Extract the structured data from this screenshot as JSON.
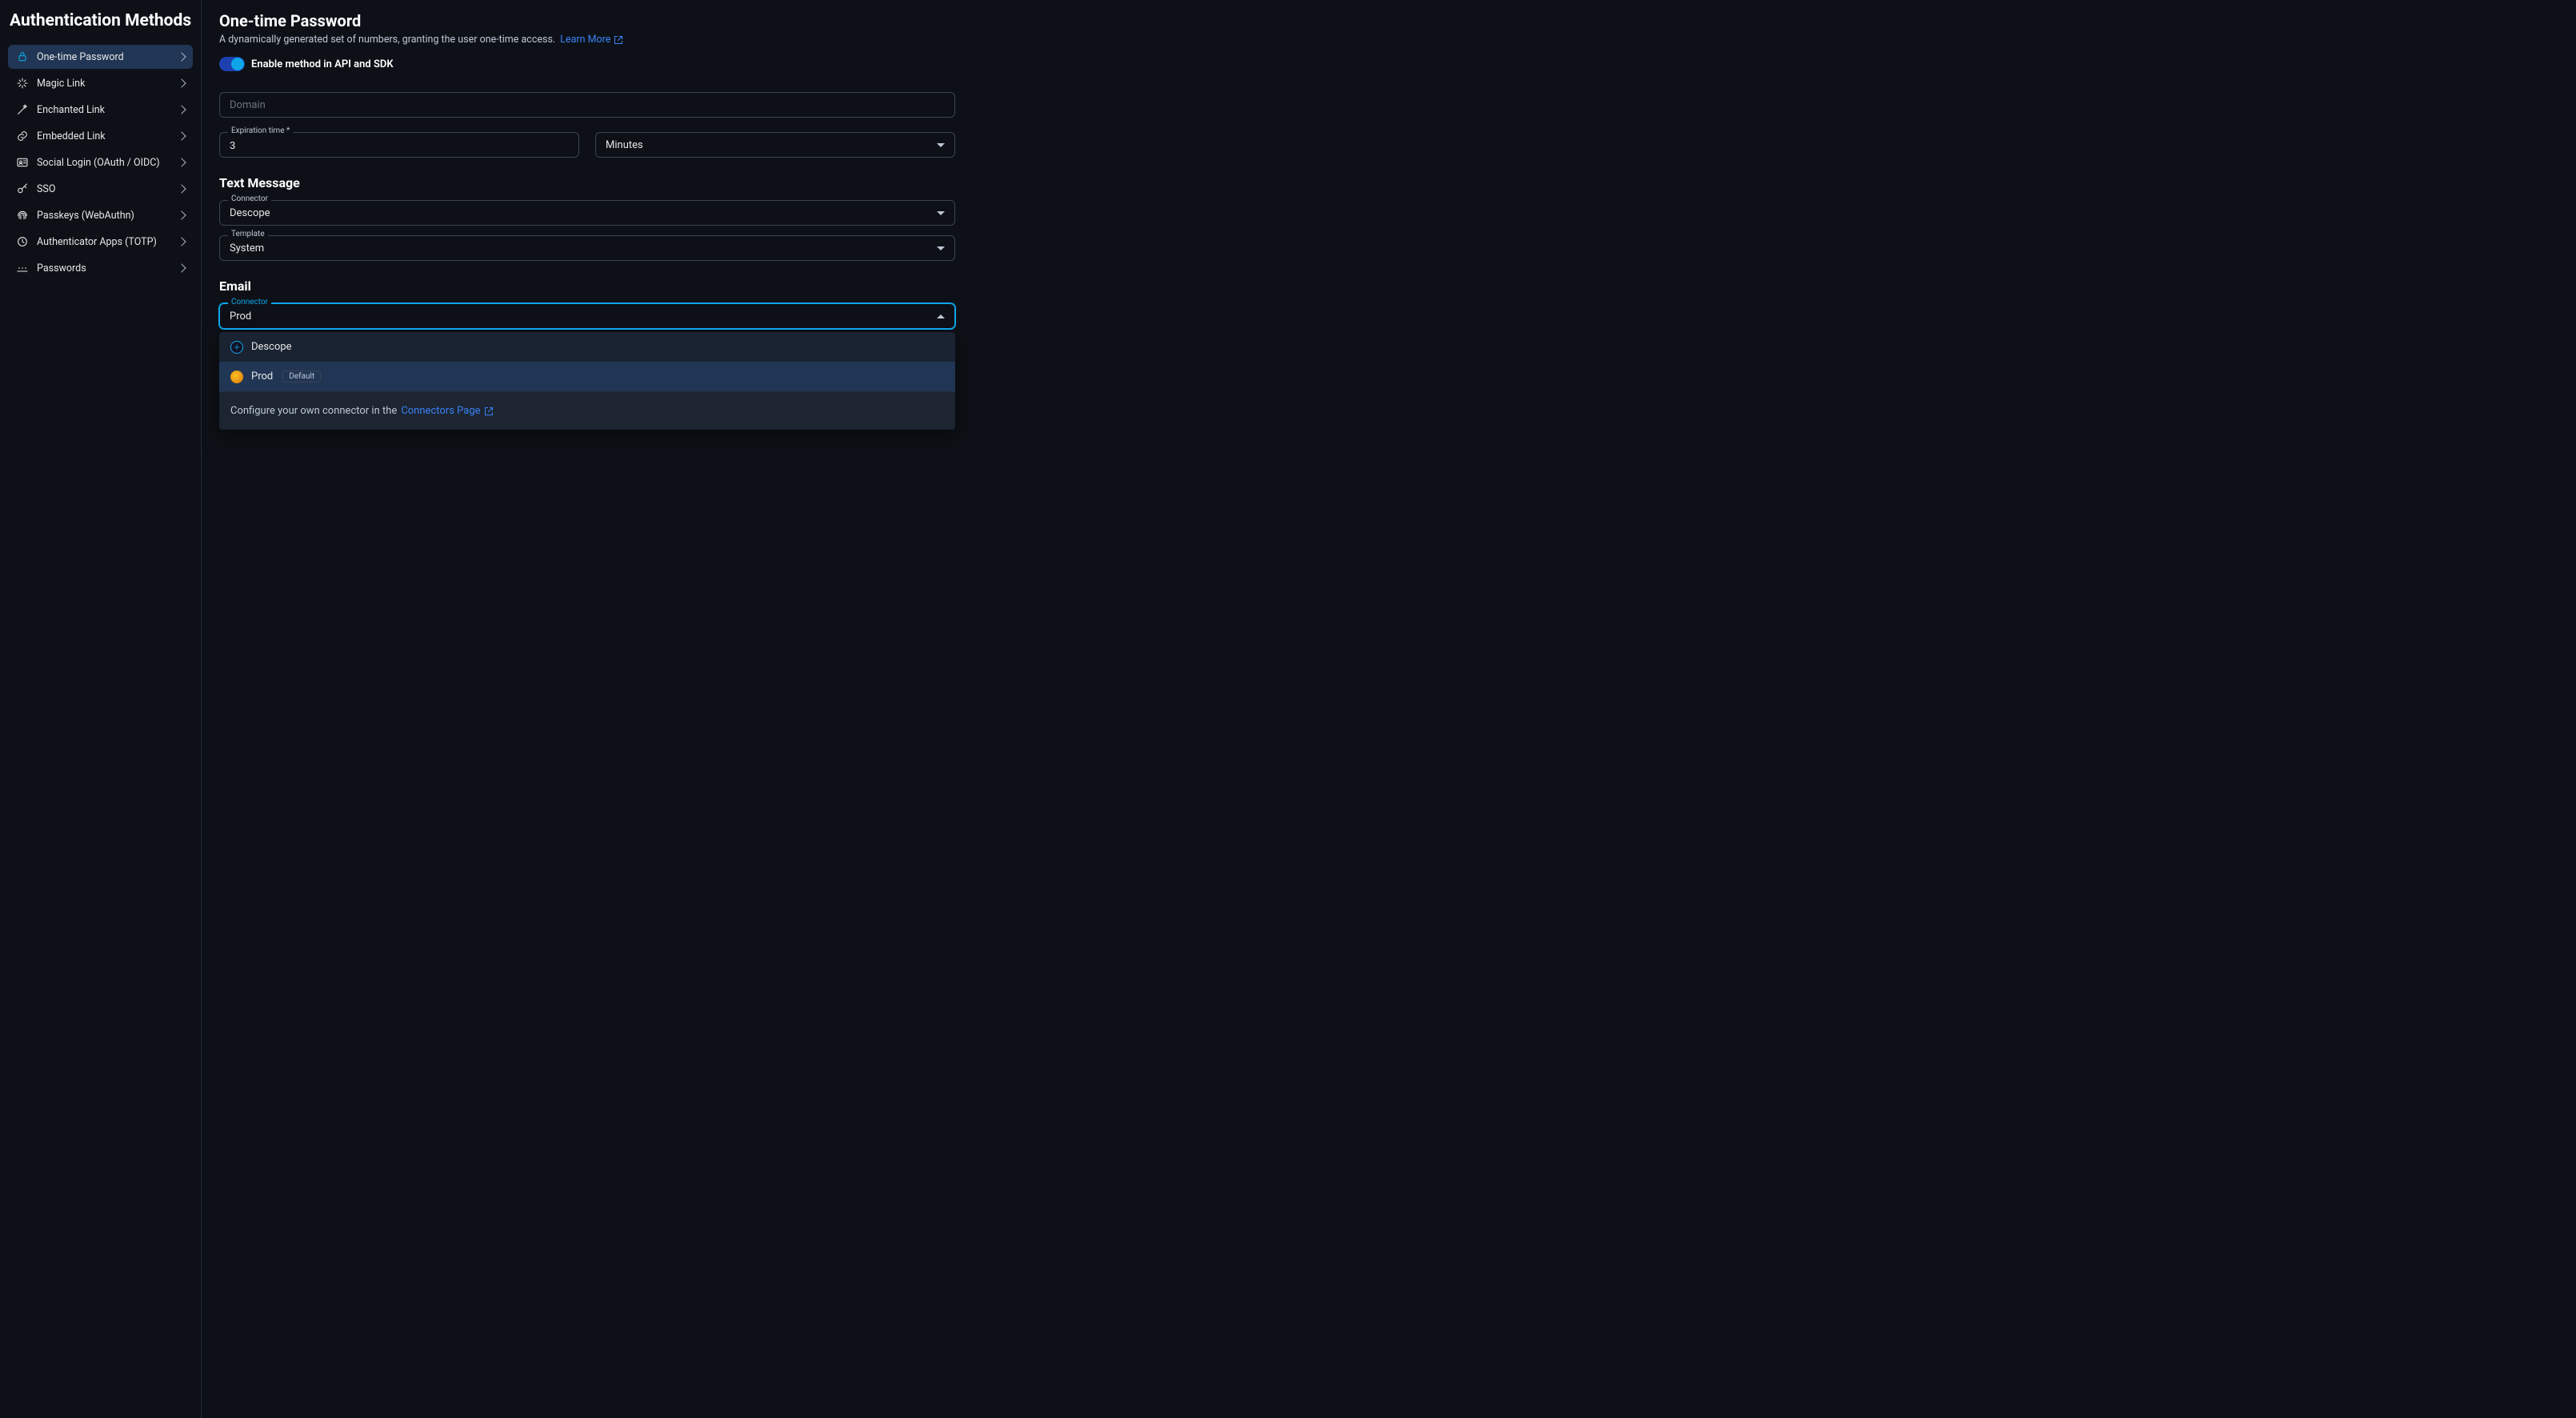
{
  "sidebar": {
    "title": "Authentication Methods",
    "items": [
      {
        "label": "One-time Password",
        "icon": "lock-shield-icon",
        "active": true
      },
      {
        "label": "Magic Link",
        "icon": "sparkle-icon",
        "active": false
      },
      {
        "label": "Enchanted Link",
        "icon": "wand-icon",
        "active": false
      },
      {
        "label": "Embedded Link",
        "icon": "link-icon",
        "active": false
      },
      {
        "label": "Social Login (OAuth / OIDC)",
        "icon": "user-card-icon",
        "active": false
      },
      {
        "label": "SSO",
        "icon": "key-icon",
        "active": false
      },
      {
        "label": "Passkeys (WebAuthn)",
        "icon": "fingerprint-icon",
        "active": false
      },
      {
        "label": "Authenticator Apps (TOTP)",
        "icon": "clock-shield-icon",
        "active": false
      },
      {
        "label": "Passwords",
        "icon": "password-dots-icon",
        "active": false
      }
    ]
  },
  "main": {
    "title": "One-time Password",
    "description": "A dynamically generated set of numbers, granting the user one-time access.",
    "learn_more_label": "Learn More",
    "toggle_label": "Enable method in API and SDK",
    "toggle_on": true,
    "domain": {
      "placeholder": "Domain",
      "value": ""
    },
    "expiration": {
      "label": "Expiration time *",
      "value": "3",
      "unit": "Minutes"
    },
    "text_message": {
      "section_title": "Text Message",
      "connector": {
        "label": "Connector",
        "value": "Descope"
      },
      "template": {
        "label": "Template",
        "value": "System"
      }
    },
    "email": {
      "section_title": "Email",
      "connector": {
        "label": "Connector",
        "value": "Prod"
      },
      "dropdown_open": true,
      "options": [
        {
          "name": "Descope",
          "icon": "descope",
          "default": false,
          "selected": false
        },
        {
          "name": "Prod",
          "icon": "prod",
          "default": true,
          "selected": true
        }
      ],
      "default_badge_text": "Default",
      "footer_text": "Configure your own connector in the",
      "footer_link": "Connectors Page"
    }
  }
}
